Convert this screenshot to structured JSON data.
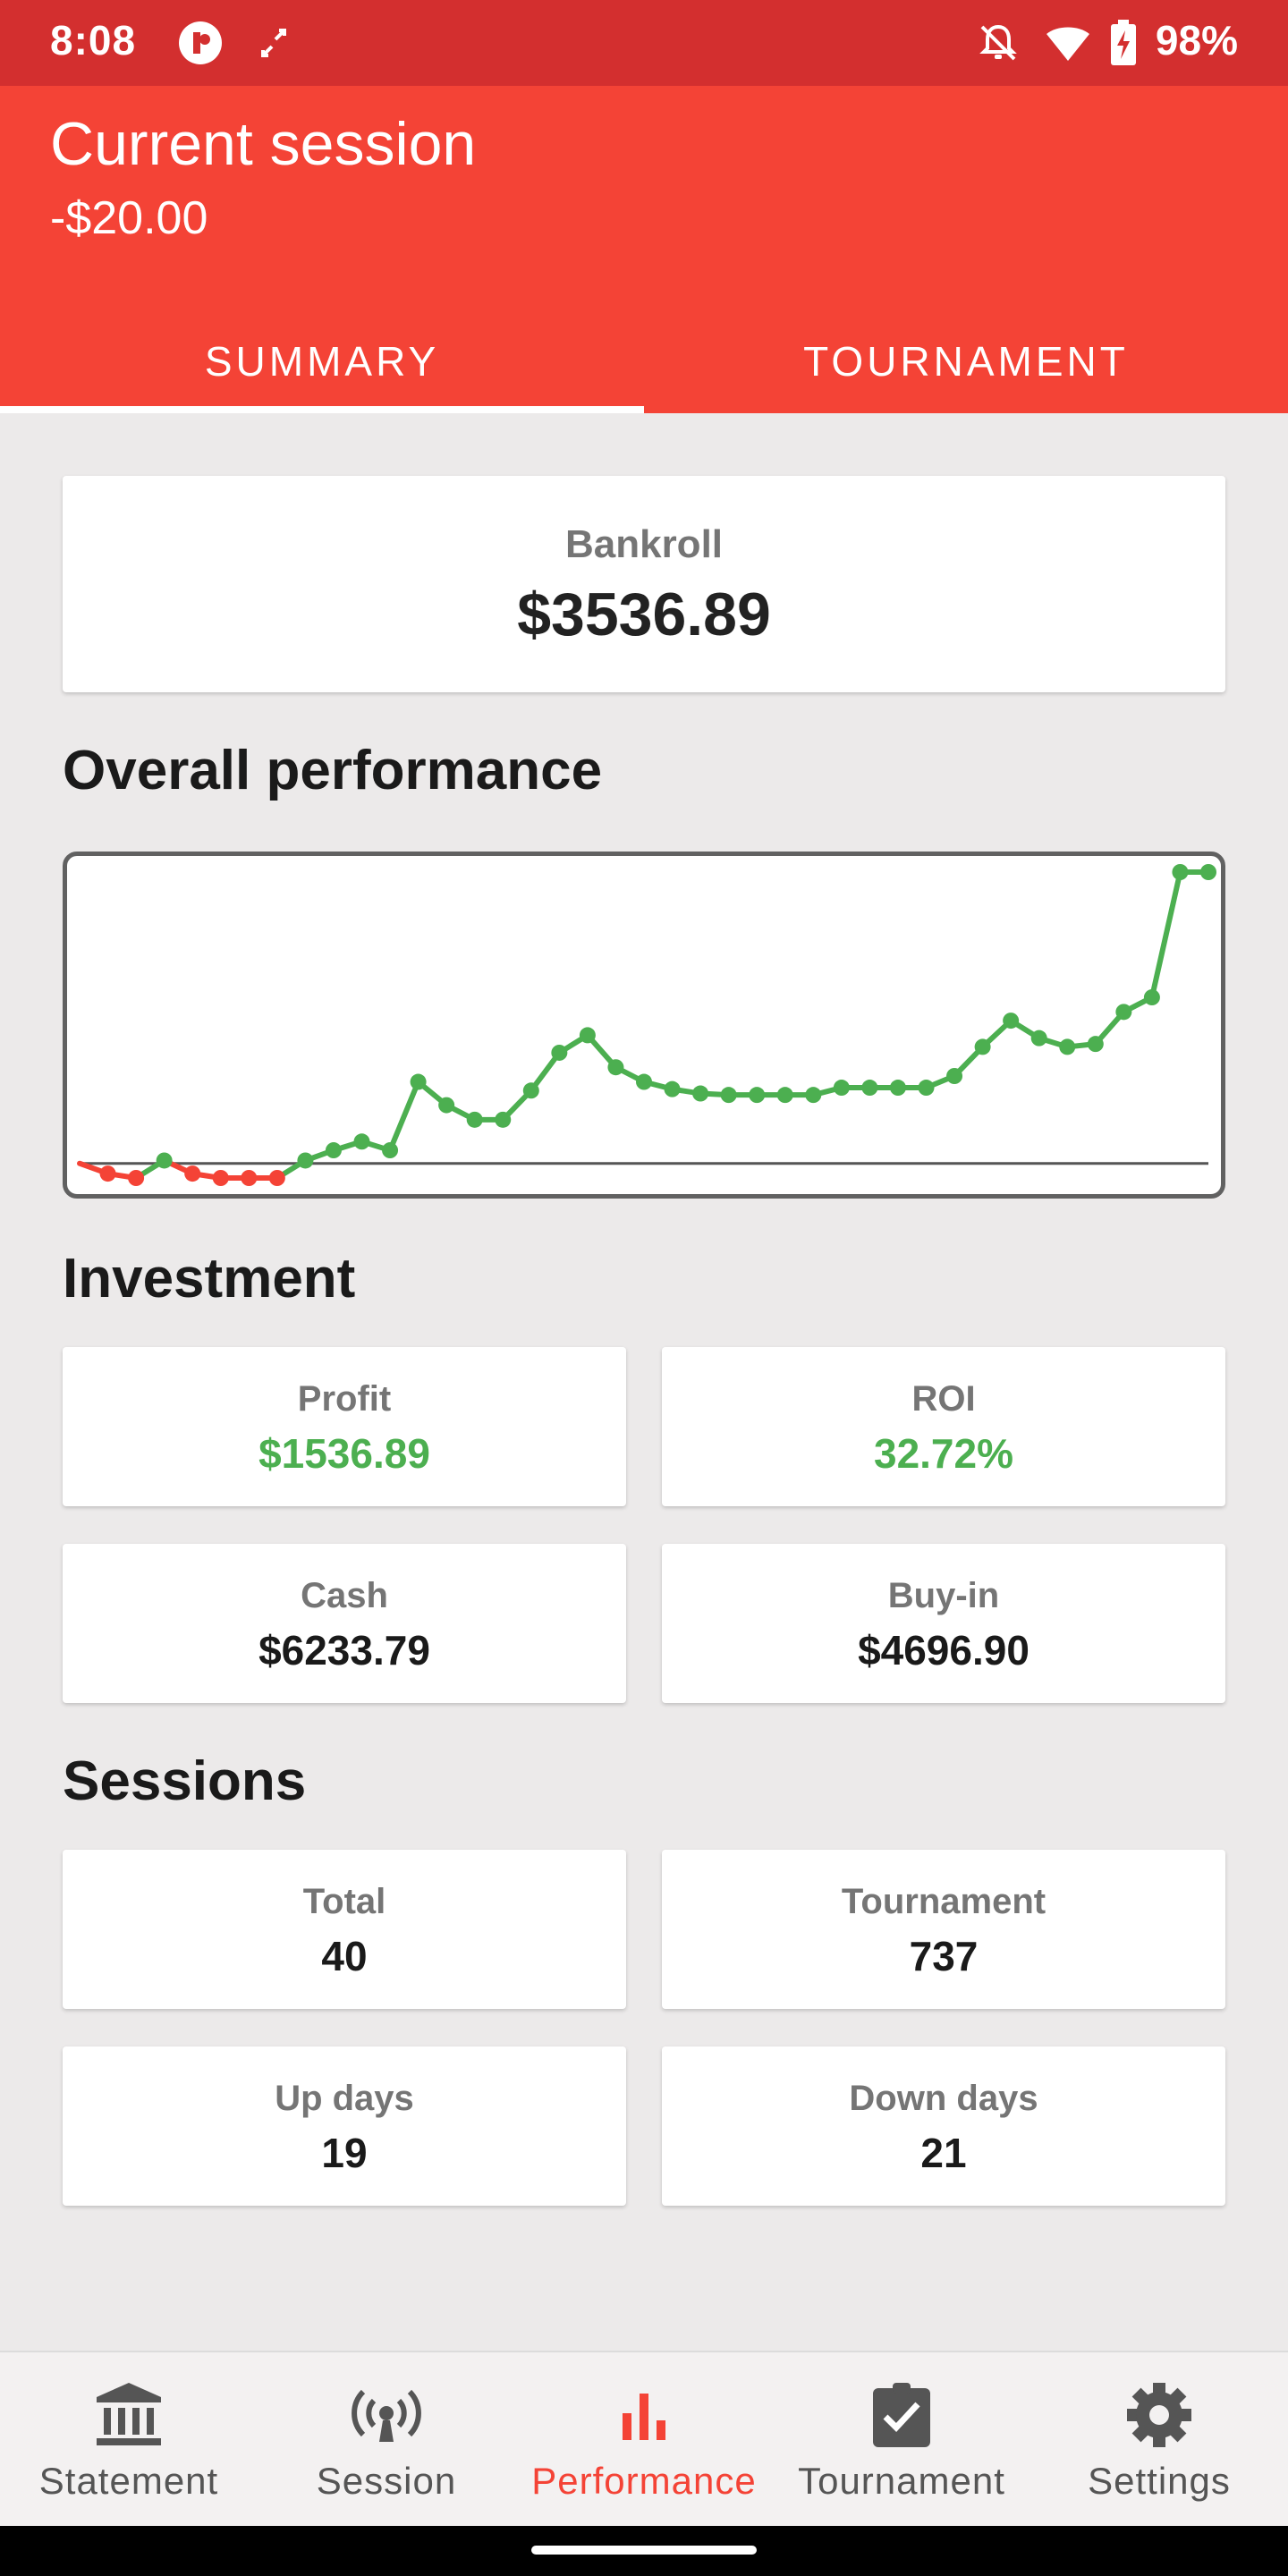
{
  "status_bar": {
    "time": "8:08",
    "battery_percent": "98%",
    "icons": [
      "app-badge-icon",
      "sync-icon",
      "notifications-off-icon",
      "wifi-icon",
      "battery-charging-icon"
    ]
  },
  "header": {
    "title": "Current session",
    "subtitle": "-$20.00"
  },
  "tabs": [
    {
      "label": "SUMMARY",
      "active": true
    },
    {
      "label": "TOURNAMENT",
      "active": false
    }
  ],
  "bankroll": {
    "label": "Bankroll",
    "value": "$3536.89"
  },
  "sections": {
    "performance": "Overall performance",
    "investment": "Investment",
    "sessions": "Sessions"
  },
  "chart_data": {
    "type": "line",
    "series": [
      {
        "values": [
          0,
          -35,
          -50,
          10,
          -35,
          -50,
          -50,
          -50,
          10,
          45,
          75,
          45,
          280,
          200,
          150,
          150,
          250,
          380,
          440,
          330,
          280,
          255,
          240,
          235,
          235,
          235,
          235,
          260,
          260,
          260,
          260,
          300,
          400,
          490,
          430,
          400,
          410,
          520,
          570,
          1000,
          1000
        ]
      }
    ],
    "baseline": 0,
    "colors": {
      "positive": "#4CAF50",
      "negative": "#F44336",
      "baseline": "#555555"
    },
    "grid": false,
    "legend": "none"
  },
  "investment": {
    "profit": {
      "label": "Profit",
      "value": "$1536.89",
      "color": "#4CAF50"
    },
    "roi": {
      "label": "ROI",
      "value": "32.72%",
      "color": "#4CAF50"
    },
    "cash": {
      "label": "Cash",
      "value": "$6233.79"
    },
    "buyin": {
      "label": "Buy-in",
      "value": "$4696.90"
    }
  },
  "sessions": {
    "total": {
      "label": "Total",
      "value": "40"
    },
    "tournament": {
      "label": "Tournament",
      "value": "737"
    },
    "up_days": {
      "label": "Up days",
      "value": "19"
    },
    "down_days": {
      "label": "Down days",
      "value": "21"
    }
  },
  "bottom_nav": [
    {
      "label": "Statement",
      "icon": "bank-icon",
      "active": false
    },
    {
      "label": "Session",
      "icon": "broadcast-icon",
      "active": false
    },
    {
      "label": "Performance",
      "icon": "bar-chart-icon",
      "active": true
    },
    {
      "label": "Tournament",
      "icon": "clipboard-check-icon",
      "active": false
    },
    {
      "label": "Settings",
      "icon": "gear-icon",
      "active": false
    }
  ],
  "theme": {
    "primary": "#F44336",
    "primary_dark": "#D32F2F",
    "background": "#ECEAEA"
  }
}
